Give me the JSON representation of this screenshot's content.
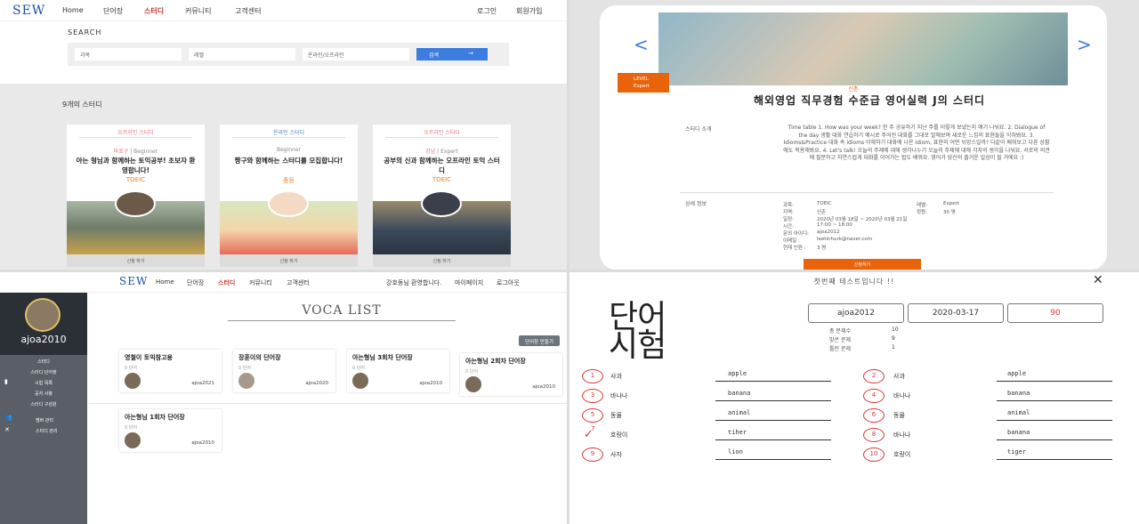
{
  "panel1": {
    "logo": "SEW",
    "nav": [
      "Home",
      "단어장",
      "스터디",
      "커뮤니티",
      "고객센터"
    ],
    "nav_right": [
      "로그인",
      "회원가입"
    ],
    "search_title": "SEARCH",
    "filters": [
      "과목",
      "레벨",
      "온라인/오프라인"
    ],
    "search_button": "검색",
    "count": "9개의 스터디",
    "cards": [
      {
        "type": "오프라인 스터디",
        "loc": "마포구",
        "level": "Beginner",
        "title": "아는 형님과 함께하는 토익공부! 초보자 환영합니다!",
        "tag": "TOEIC",
        "join": "신청 하기"
      },
      {
        "type": "온라인 스터디",
        "loc": "",
        "level": "Beginner",
        "title": "짱구와 함께하는 스터디를 모집합니다!",
        "tag": "중등",
        "join": "신청 하기"
      },
      {
        "type": "오프라인 스터디",
        "loc": "강남",
        "level": "Expert",
        "title": "공부의 신과 함께하는 오프라인 토익 스터디",
        "tag": "TOEIC",
        "join": "신청 하기"
      }
    ]
  },
  "panel2": {
    "level_label": "LEVEL",
    "level_value": "Expert",
    "new_tag": "신촌",
    "title": "해외영업 직무경험 수준급 영어실력 J의 스터디",
    "intro_label": "스터디 소개",
    "intro_text": "Time table 1. How was your week? 한 주 공유하기 지난 주를 이렇게 보냈는지 얘기 나눠요. 2. Dialogue of the day 생활 대화 연습하기 예시로 주어진 대화를 그대로 말해보며 새로운 느낌의 표현들을 익혀봐요. 3. Idioms&Practice 대화 속 idioms 이해하기 대화에 나온 idiom, 표현의 어떤 뉘앙스일까? 다같이 배워보고 다른 상황에도 적용해봐요. 4. Let's talk! 오늘의 주제에 대해 생각나누기 오늘의 주제에 대해 각자의 생각을 나눠요. 서로의 의견에 질문하고 자연스럽게 대화를 이어가는 법도 배워요. 영어가 당신의 즐거운 일상이 될 거에요 :)",
    "detail_label": "상세 정보",
    "info": [
      [
        "과목:",
        "TOEIC",
        "레벨:",
        "Expert"
      ],
      [
        "지역:",
        "신촌",
        "정원:",
        "30 명"
      ],
      [
        "일정:",
        "2020년 03월 18일 ~ 2020년 03월 21일",
        "",
        ""
      ],
      [
        "시간:",
        "17:00 ~ 18:00",
        "",
        ""
      ],
      [
        "문의 아이디:",
        "ajoa2012",
        "",
        ""
      ],
      [
        "이메일 :",
        "leetinhurk@naver.com",
        "",
        ""
      ],
      [
        "현재 인원 :",
        "3 명",
        "",
        ""
      ]
    ],
    "apply": "신청하기"
  },
  "panel3": {
    "logo": "SEW",
    "nav": [
      "Home",
      "단어장",
      "스터디",
      "커뮤니티",
      "고객센터"
    ],
    "welcome": "강호동님 환영합니다.",
    "mypage": "마이페이지",
    "logout": "로그아웃",
    "username": "ajoa2010",
    "side_items": [
      "스터디",
      "스터디 단어장",
      "시험 목록",
      "공지 사항",
      "스터디 구성원"
    ],
    "side_groups": [
      "멤버 관리",
      "스터디 관리"
    ],
    "title": "VOCA LIST",
    "make_button": "단어장 만들기",
    "cards": [
      {
        "title": "영철이 토익참고용",
        "count": "0 단어",
        "user": "ajoa2021"
      },
      {
        "title": "장훈이의 단어장",
        "count": "0 단어",
        "user": "ajoa2020"
      },
      {
        "title": "아는형님 3회차 단어장",
        "count": "0 단어",
        "user": "ajoa2010"
      },
      {
        "title": "아는형님 2회차 단어장",
        "count": "0 단어",
        "user": "ajoa2010"
      },
      {
        "title": "아는형님 1회차 단어장",
        "count": "0 단어",
        "user": "ajoa2010"
      }
    ]
  },
  "panel4": {
    "header": "첫번째 테스트입니다 !!",
    "big_title_1": "단어",
    "big_title_2": "시험",
    "user": "ajoa2012",
    "date": "2020-03-17",
    "score": "90",
    "stats": [
      [
        "총 문제수",
        "10"
      ],
      [
        "맞은 문제",
        "9"
      ],
      [
        "틀린 문제",
        "1"
      ]
    ],
    "left": [
      {
        "num": "1",
        "word": "사과",
        "answer": "apple",
        "correct": true
      },
      {
        "num": "3",
        "word": "바나나",
        "answer": "banana",
        "correct": true
      },
      {
        "num": "5",
        "word": "동물",
        "answer": "animal",
        "correct": true
      },
      {
        "num": "7",
        "word": "호랑이",
        "answer": "tiher",
        "correct": false
      },
      {
        "num": "9",
        "word": "사자",
        "answer": "lion",
        "correct": true
      }
    ],
    "right": [
      {
        "num": "2",
        "word": "사과",
        "answer": "apple",
        "correct": true
      },
      {
        "num": "4",
        "word": "바나나",
        "answer": "banana",
        "correct": true
      },
      {
        "num": "6",
        "word": "동물",
        "answer": "animal",
        "correct": true
      },
      {
        "num": "8",
        "word": "바나나",
        "answer": "banana",
        "correct": true
      },
      {
        "num": "10",
        "word": "호랑이",
        "answer": "tiger",
        "correct": true
      }
    ]
  }
}
